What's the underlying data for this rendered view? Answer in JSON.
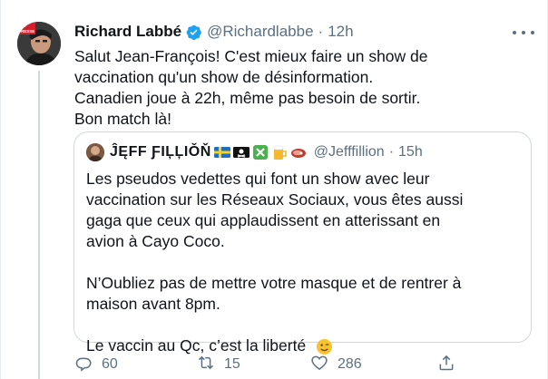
{
  "author": {
    "name": "Richard Labbé",
    "handle": "@Richardlabbe",
    "separator": "·",
    "time": "12h",
    "avatar_badge_lines": [
      "LA",
      "PRESSE"
    ]
  },
  "body_lines": [
    "Salut Jean-François! C'est mieux faire un show de",
    "vaccination qu'un show de désinformation.",
    "Canadien joue à 22h, même pas besoin de sortir.",
    "Bon match là!"
  ],
  "quote": {
    "name": "ĴĘFF ƑIĻĻIǑŇ",
    "handle": "@Jefffillion",
    "separator": "·",
    "time": "15h",
    "emojis": [
      "sweden-flag-icon",
      "pirate-flag-icon",
      "cross-mark-icon",
      "beer-icon",
      "steak-icon"
    ],
    "lines": [
      "Les pseudos vedettes qui font un show avec leur",
      "vaccination sur les Réseaux Sociaux, vous êtes aussi",
      "gaga que ceux qui applaudissent en atterissant en",
      "avion à Cayo Coco.",
      "",
      "N’Oubliez pas de mettre votre masque et de rentrer à",
      "maison avant 8pm.",
      "",
      "Le vaccin au Qc, c’est la liberté"
    ]
  },
  "actions": {
    "replies": "60",
    "retweets": "15",
    "likes": "286"
  },
  "colors": {
    "text": "#0f1419",
    "secondary": "#5b7083",
    "verified": "#1da1f2",
    "border": "#cfd9de"
  }
}
